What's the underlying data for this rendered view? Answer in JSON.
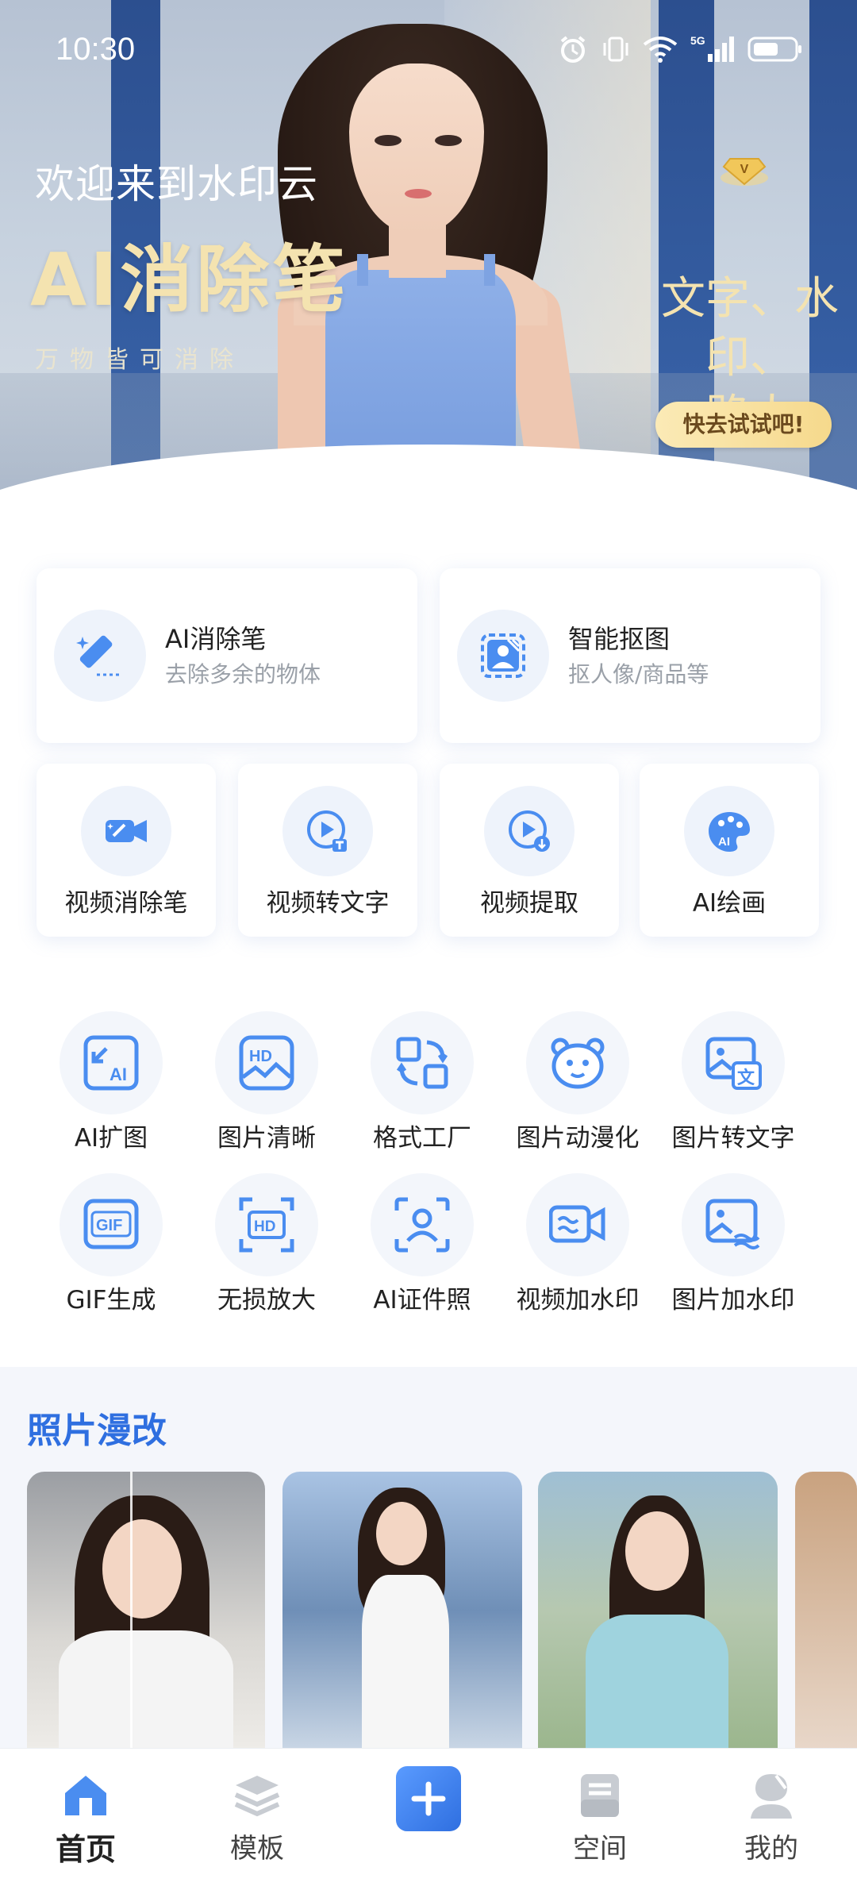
{
  "status_bar": {
    "time": "10:30",
    "network": "5G"
  },
  "hero": {
    "greeting": "欢迎来到水印云",
    "title": "AI消除笔",
    "subtitle": "万物皆可消除",
    "right_text_line1": "文字、水印、",
    "right_text_line2": "路人",
    "cta": "快去试试吧!"
  },
  "feature_cards": [
    {
      "title": "AI消除笔",
      "desc": "去除多余的物体",
      "icon": "eraser-pen-icon"
    },
    {
      "title": "智能抠图",
      "desc": "抠人像/商品等",
      "icon": "cutout-icon"
    }
  ],
  "small_cards": [
    {
      "label": "视频消除笔",
      "icon": "video-eraser-icon"
    },
    {
      "label": "视频转文字",
      "icon": "video-to-text-icon"
    },
    {
      "label": "视频提取",
      "icon": "video-extract-icon"
    },
    {
      "label": "AI绘画",
      "icon": "ai-painting-icon"
    }
  ],
  "tools_row1": [
    {
      "label": "AI扩图",
      "icon": "ai-expand-icon"
    },
    {
      "label": "图片清晰",
      "icon": "hd-image-icon"
    },
    {
      "label": "格式工厂",
      "icon": "format-factory-icon"
    },
    {
      "label": "图片动漫化",
      "icon": "anime-icon"
    },
    {
      "label": "图片转文字",
      "icon": "image-to-text-icon"
    }
  ],
  "tools_row2": [
    {
      "label": "GIF生成",
      "icon": "gif-icon"
    },
    {
      "label": "无损放大",
      "icon": "hd-upscale-icon"
    },
    {
      "label": "AI证件照",
      "icon": "id-photo-icon"
    },
    {
      "label": "视频加水印",
      "icon": "video-watermark-icon"
    },
    {
      "label": "图片加水印",
      "icon": "image-watermark-icon"
    }
  ],
  "photo_section": {
    "title": "照片漫改"
  },
  "bottom_nav": [
    {
      "label": "首页",
      "icon": "home-icon",
      "active": true
    },
    {
      "label": "模板",
      "icon": "layers-icon",
      "active": false
    },
    {
      "label": "",
      "icon": "plus-icon",
      "active": false
    },
    {
      "label": "空间",
      "icon": "storage-icon",
      "active": false
    },
    {
      "label": "我的",
      "icon": "profile-icon",
      "active": false
    }
  ],
  "colors": {
    "accent": "#2f6fe0",
    "icon_blue": "#4a8df0",
    "gold": "#f4e3b0"
  }
}
